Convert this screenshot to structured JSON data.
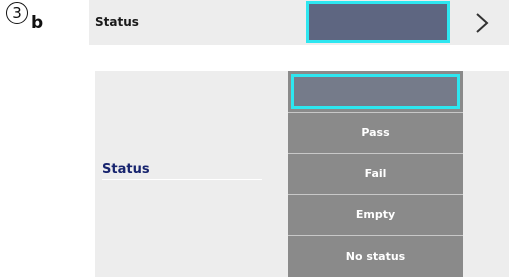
{
  "step": {
    "number": "3",
    "letter": "b"
  },
  "top_row": {
    "label": "Status",
    "value": "",
    "icon": "chevron-right-icon"
  },
  "panel": {
    "label": "Status",
    "selected_value": "",
    "options": [
      "Pass",
      "Fail",
      "Empty",
      "No status"
    ]
  },
  "colors": {
    "focus_border": "#2ee6f0",
    "top_value_bg": "#5e6681",
    "dropdown_bg": "#8a8a8a",
    "label_blue": "#17246e"
  }
}
